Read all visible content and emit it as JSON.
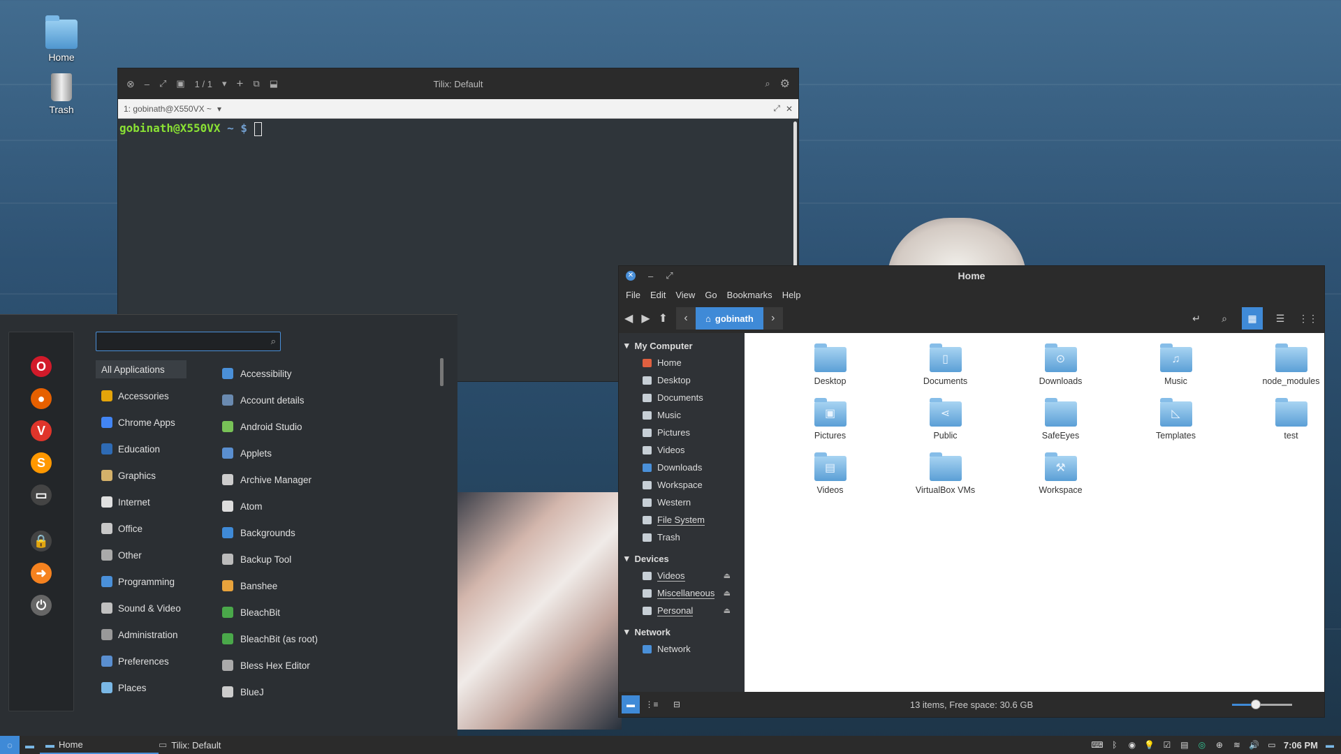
{
  "desktop": {
    "icons": [
      {
        "label": "Home"
      },
      {
        "label": "Trash"
      }
    ]
  },
  "terminal": {
    "title": "Tilix: Default",
    "session": "1 / 1",
    "tab_label": "1: gobinath@X550VX ~",
    "prompt_user": "gobinath@X550VX",
    "prompt_path": "~ $"
  },
  "menu": {
    "search_placeholder": "",
    "categories": [
      {
        "label": "All Applications",
        "color": "#3a3f44"
      },
      {
        "label": "Accessories",
        "color": "#e5a50a"
      },
      {
        "label": "Chrome Apps",
        "color": "#4285f4"
      },
      {
        "label": "Education",
        "color": "#2e6bb5"
      },
      {
        "label": "Graphics",
        "color": "#d4b16a"
      },
      {
        "label": "Internet",
        "color": "#e0e0e0"
      },
      {
        "label": "Office",
        "color": "#c8c8c8"
      },
      {
        "label": "Other",
        "color": "#aaaaaa"
      },
      {
        "label": "Programming",
        "color": "#4a90d9"
      },
      {
        "label": "Sound & Video",
        "color": "#c0c0c0"
      },
      {
        "label": "Administration",
        "color": "#999999"
      },
      {
        "label": "Preferences",
        "color": "#5a8fd0"
      },
      {
        "label": "Places",
        "color": "#7ab8e6"
      }
    ],
    "apps": [
      {
        "label": "Accessibility",
        "color": "#4a90d9"
      },
      {
        "label": "Account details",
        "color": "#6a8ab0"
      },
      {
        "label": "Android Studio",
        "color": "#78c257"
      },
      {
        "label": "Applets",
        "color": "#5a8fd0"
      },
      {
        "label": "Archive Manager",
        "color": "#cccccc"
      },
      {
        "label": "Atom",
        "color": "#dddddd"
      },
      {
        "label": "Backgrounds",
        "color": "#3f8ad7"
      },
      {
        "label": "Backup Tool",
        "color": "#bbbbbb"
      },
      {
        "label": "Banshee",
        "color": "#e8a33c"
      },
      {
        "label": "BleachBit",
        "color": "#4aa84a"
      },
      {
        "label": "BleachBit (as root)",
        "color": "#4aa84a"
      },
      {
        "label": "Bless Hex Editor",
        "color": "#aaaaaa"
      },
      {
        "label": "BlueJ",
        "color": "#cccccc"
      }
    ],
    "favorites": [
      {
        "name": "opera-icon",
        "glyph": "O",
        "color": "#d21a2a"
      },
      {
        "name": "firefox-icon",
        "glyph": "●",
        "color": "#e66000"
      },
      {
        "name": "vivaldi-icon",
        "glyph": "V",
        "color": "#e0352b"
      },
      {
        "name": "sublime-icon",
        "glyph": "S",
        "color": "#ff9800"
      },
      {
        "name": "monitor-icon",
        "glyph": "▭",
        "color": "#444444"
      },
      {
        "name": "lock-icon",
        "glyph": "🔒",
        "color": "#444444"
      },
      {
        "name": "logout-icon",
        "glyph": "➜",
        "color": "#f5821f"
      },
      {
        "name": "power-icon",
        "glyph": "⏻",
        "color": "#666666"
      }
    ]
  },
  "files": {
    "title": "Home",
    "menubar": [
      "File",
      "Edit",
      "View",
      "Go",
      "Bookmarks",
      "Help"
    ],
    "location": "gobinath",
    "sidebar": {
      "sections": [
        {
          "header": "My Computer",
          "items": [
            {
              "label": "Home",
              "color": "#e06040"
            },
            {
              "label": "Desktop",
              "color": "#c7cfd6"
            },
            {
              "label": "Documents",
              "color": "#c7cfd6"
            },
            {
              "label": "Music",
              "color": "#c7cfd6"
            },
            {
              "label": "Pictures",
              "color": "#c7cfd6"
            },
            {
              "label": "Videos",
              "color": "#c7cfd6"
            },
            {
              "label": "Downloads",
              "color": "#4a90d9"
            },
            {
              "label": "Workspace",
              "color": "#c7cfd6"
            },
            {
              "label": "Western",
              "color": "#c7cfd6"
            },
            {
              "label": "File System",
              "color": "#c7cfd6",
              "underline": true
            },
            {
              "label": "Trash",
              "color": "#c7cfd6"
            }
          ]
        },
        {
          "header": "Devices",
          "items": [
            {
              "label": "Videos",
              "color": "#c7cfd6",
              "underline": true,
              "eject": true
            },
            {
              "label": "Miscellaneous",
              "color": "#c7cfd6",
              "underline": true,
              "eject": true
            },
            {
              "label": "Personal",
              "color": "#c7cfd6",
              "underline": true,
              "eject": true
            }
          ]
        },
        {
          "header": "Network",
          "items": [
            {
              "label": "Network",
              "color": "#4a90d9"
            }
          ]
        }
      ]
    },
    "items": [
      {
        "label": "Desktop",
        "glyph": ""
      },
      {
        "label": "Documents",
        "glyph": "▯"
      },
      {
        "label": "Downloads",
        "glyph": "⊙"
      },
      {
        "label": "Music",
        "glyph": "♫"
      },
      {
        "label": "node_modules",
        "glyph": ""
      },
      {
        "label": "Pictures",
        "glyph": "▣"
      },
      {
        "label": "Public",
        "glyph": "⋖"
      },
      {
        "label": "SafeEyes",
        "glyph": ""
      },
      {
        "label": "Templates",
        "glyph": "◺"
      },
      {
        "label": "test",
        "glyph": ""
      },
      {
        "label": "Videos",
        "glyph": "▤"
      },
      {
        "label": "VirtualBox VMs",
        "glyph": ""
      },
      {
        "label": "Workspace",
        "glyph": "⚒"
      }
    ],
    "status": "13 items, Free space: 30.6 GB",
    "zoom_fraction": 0.4
  },
  "panel": {
    "windows": [
      {
        "label": "Home",
        "active": true
      },
      {
        "label": "Tilix: Default",
        "active": false
      }
    ],
    "clock": "7:06 PM"
  }
}
